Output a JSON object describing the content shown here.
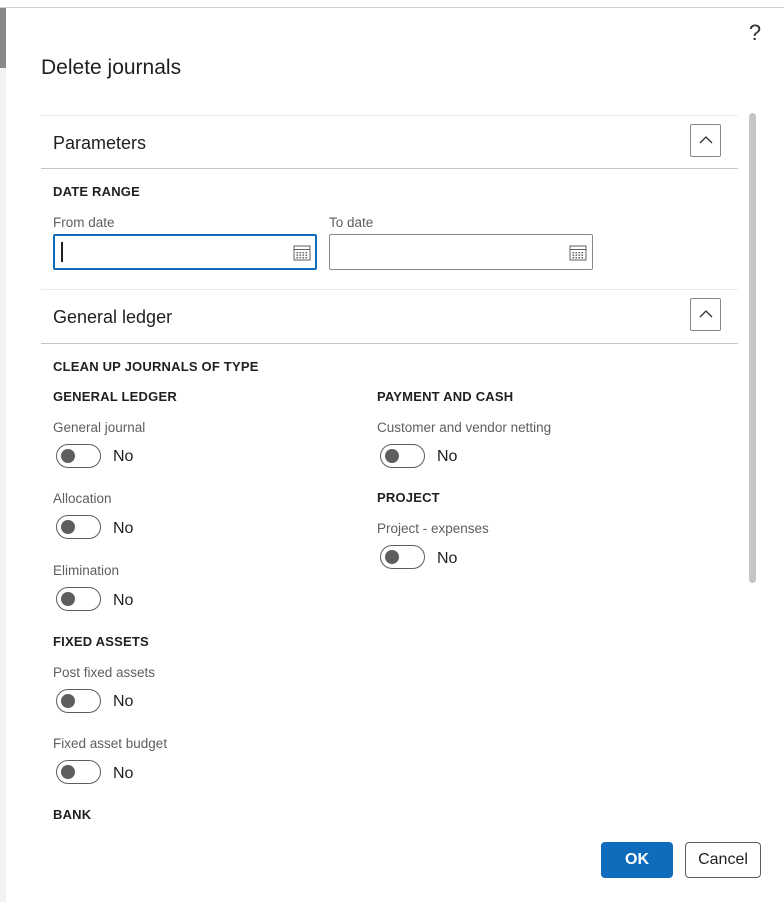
{
  "dialog": {
    "title": "Delete journals",
    "help": "?"
  },
  "parameters": {
    "title": "Parameters",
    "date_range_label": "DATE RANGE",
    "from_date": {
      "label": "From date",
      "value": ""
    },
    "to_date": {
      "label": "To date",
      "value": ""
    }
  },
  "general_ledger_section": {
    "title": "General ledger",
    "heading": "CLEAN UP JOURNALS OF TYPE",
    "general_ledger": {
      "label": "GENERAL LEDGER",
      "items": [
        {
          "label": "General journal",
          "value": "No"
        },
        {
          "label": "Allocation",
          "value": "No"
        },
        {
          "label": "Elimination",
          "value": "No"
        }
      ]
    },
    "fixed_assets": {
      "label": "FIXED ASSETS",
      "items": [
        {
          "label": "Post fixed assets",
          "value": "No"
        },
        {
          "label": "Fixed asset budget",
          "value": "No"
        }
      ]
    },
    "bank": {
      "label": "BANK"
    },
    "payment_and_cash": {
      "label": "PAYMENT AND CASH",
      "items": [
        {
          "label": "Customer and vendor netting",
          "value": "No"
        }
      ]
    },
    "project": {
      "label": "PROJECT",
      "items": [
        {
          "label": "Project - expenses",
          "value": "No"
        }
      ]
    }
  },
  "footer": {
    "ok": "OK",
    "cancel": "Cancel"
  },
  "colors": {
    "primary": "#0f6cbd",
    "text": "#201f1e",
    "muted": "#605e5c"
  }
}
